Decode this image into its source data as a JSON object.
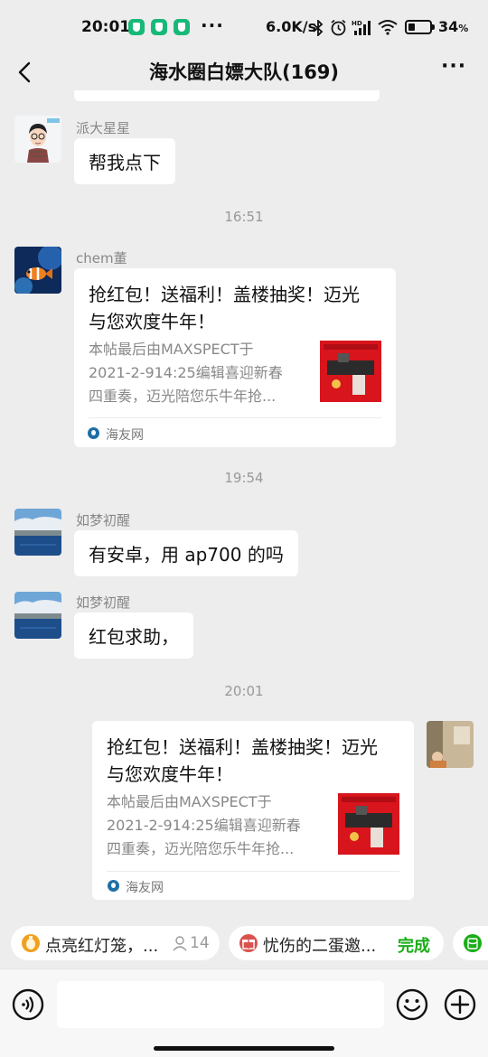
{
  "status_bar": {
    "time": "20:01",
    "more": "···",
    "network_speed": "6.0K/s",
    "battery_percent": "34",
    "battery_level": 0.34,
    "icons": [
      "shield-icon",
      "bluetooth-icon",
      "alarm-icon",
      "signal-icon",
      "wifi-icon",
      "battery-icon"
    ]
  },
  "header": {
    "title": "海水圈白嫖大队(169)",
    "back_icon": "chevron-left-icon",
    "more_label": "···"
  },
  "messages": [
    {
      "type": "text",
      "sender": "派大星星",
      "text": "帮我点下"
    },
    {
      "type": "time",
      "text": "16:51"
    },
    {
      "type": "card",
      "sender": "chem董",
      "title": "抢红包！送福利！盖楼抽奖！迈光与您欢度牛年！",
      "title_lines": [
        "抢红包！送福利！盖楼抽奖！迈光",
        "与您欢度牛年！"
      ],
      "desc_lines": [
        "本帖最后由MAXSPECT于",
        "2021-2-914:25编辑喜迎新春",
        "四重奏，迈光陪您乐牛年抢..."
      ],
      "source": "海友网"
    },
    {
      "type": "time",
      "text": "19:54"
    },
    {
      "type": "text",
      "sender": "如梦初醒",
      "text": "有安卓，用 ap700 的吗"
    },
    {
      "type": "text",
      "sender": "如梦初醒",
      "text": "红包求助，"
    },
    {
      "type": "time",
      "text": "20:01"
    },
    {
      "type": "card",
      "sender": "self",
      "title_lines": [
        "抢红包！送福利！盖楼抽奖！迈光",
        "与您欢度牛年！"
      ],
      "desc_lines": [
        "本帖最后由MAXSPECT于",
        "2021-2-914:25编辑喜迎新春",
        "四重奏，迈光陪您乐牛年抢..."
      ],
      "source": "海友网"
    }
  ],
  "topics": [
    {
      "text": "点亮红灯笼，...",
      "count": "14",
      "icon": "lantern-icon"
    },
    {
      "text": "忧伤的二蛋邀...",
      "action": "完成",
      "icon": "gift-icon"
    },
    {
      "icon": "redpacket-icon"
    }
  ],
  "input_bar": {
    "voice_icon": "voice-icon",
    "emoji_icon": "emoji-icon",
    "plus_icon": "plus-icon",
    "text_value": ""
  },
  "colors": {
    "background": "#ededed",
    "bubble": "#ffffff",
    "accent_green": "#1aad19",
    "muted_text": "#888888"
  }
}
